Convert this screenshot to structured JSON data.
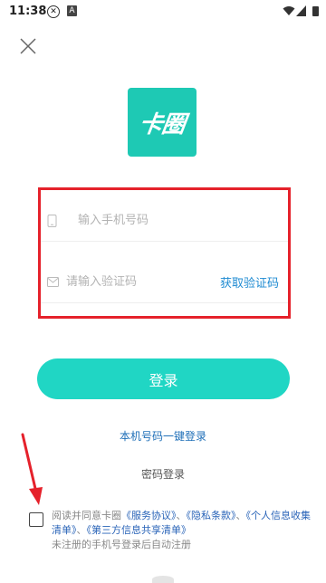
{
  "status_bar": {
    "time": "11:38",
    "icons": [
      "x-circle-icon",
      "a-notification-icon",
      "wifi-icon",
      "signal-icon",
      "battery-icon"
    ]
  },
  "close_icon": "close-icon",
  "logo": {
    "text": "卡圈",
    "color": "#1ec9b4"
  },
  "form": {
    "phone_placeholder": "输入手机号码",
    "phone_icon": "phone-icon",
    "code_placeholder": "请输入验证码",
    "code_icon": "mail-icon",
    "get_code_label": "获取验证码"
  },
  "login_button": {
    "label": "登录",
    "color": "#20d6c4"
  },
  "one_click_login_label": "本机号码一键登录",
  "password_login_label": "密码登录",
  "agreement": {
    "prefix": "阅读并同意卡圈",
    "link_service": "《服务协议》",
    "separator_1": "、",
    "link_privacy": "《隐私条款》",
    "separator_2": "、",
    "link_personal_info": "《个人信息收集清单》",
    "separator_3": "、",
    "link_third_party": "《第三方信息共享清单》",
    "note": "未注册的手机号登录后自动注册"
  },
  "annotation_color": "#e5212b"
}
